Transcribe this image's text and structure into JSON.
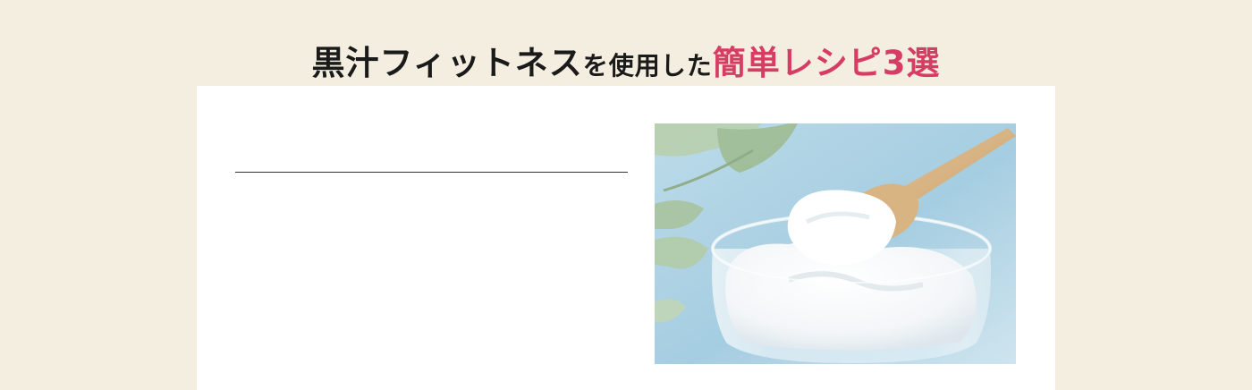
{
  "heading": {
    "part1": "黒汁フィットネス",
    "part2": "を使用した",
    "part3": "簡単レシピ3選"
  },
  "colors": {
    "background": "#f4eee0",
    "card": "#ffffff",
    "accent": "#d63d64",
    "text": "#1a1a1a"
  }
}
